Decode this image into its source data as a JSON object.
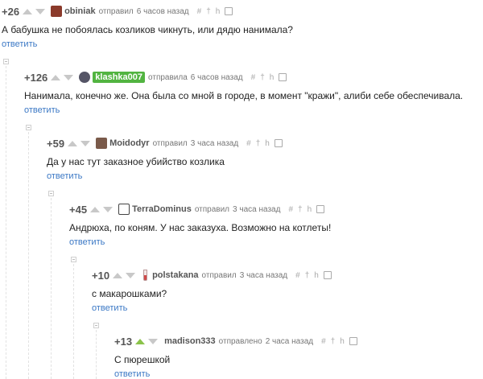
{
  "colors": {
    "reply_link": "#3b78c5",
    "badge_green": "#52b441",
    "upvote_active": "#8bc34a"
  },
  "tool_icons": [
    "hash-icon",
    "pin-icon",
    "branch-icon",
    "save-icon"
  ],
  "comments": [
    {
      "rating": "+26",
      "username": "obiniak",
      "action": "отправил",
      "time": "6 часов назад",
      "text": "А бабушка не побоялась козликов чикнуть, или дядю нанимала?",
      "reply": "ответить",
      "avatar_icon": "user-avatar-icon"
    },
    {
      "rating": "+126",
      "username": "klashka007",
      "action": "отправила",
      "time": "6 часов назад",
      "text": "Нанимала, конечно же. Она была со мной в городе, в момент \"кражи\", алиби себе обеспечивала.",
      "reply": "ответить",
      "avatar_icon": "user-avatar-icon"
    },
    {
      "rating": "+59",
      "username": "Moidodyr",
      "action": "отправил",
      "time": "3 часа назад",
      "text": "Да у нас тут заказное убийство козлика",
      "reply": "ответить",
      "avatar_icon": "user-avatar-icon"
    },
    {
      "rating": "+45",
      "username": "TerraDominus",
      "action": "отправил",
      "time": "3 часа назад",
      "text": "Андрюха, по коням. У нас заказуха. Возможно на котлеты!",
      "reply": "ответить",
      "avatar_icon": "user-avatar-icon"
    },
    {
      "rating": "+10",
      "username": "polstakana",
      "action": "отправил",
      "time": "3 часа назад",
      "text": "с макарошками?",
      "reply": "ответить",
      "avatar_icon": "glass-icon"
    },
    {
      "rating": "+13",
      "username": "madison333",
      "action": "отправлено",
      "time": "2 часа назад",
      "text": "С пюрешкой",
      "reply": "ответить",
      "avatar_icon": ""
    }
  ]
}
